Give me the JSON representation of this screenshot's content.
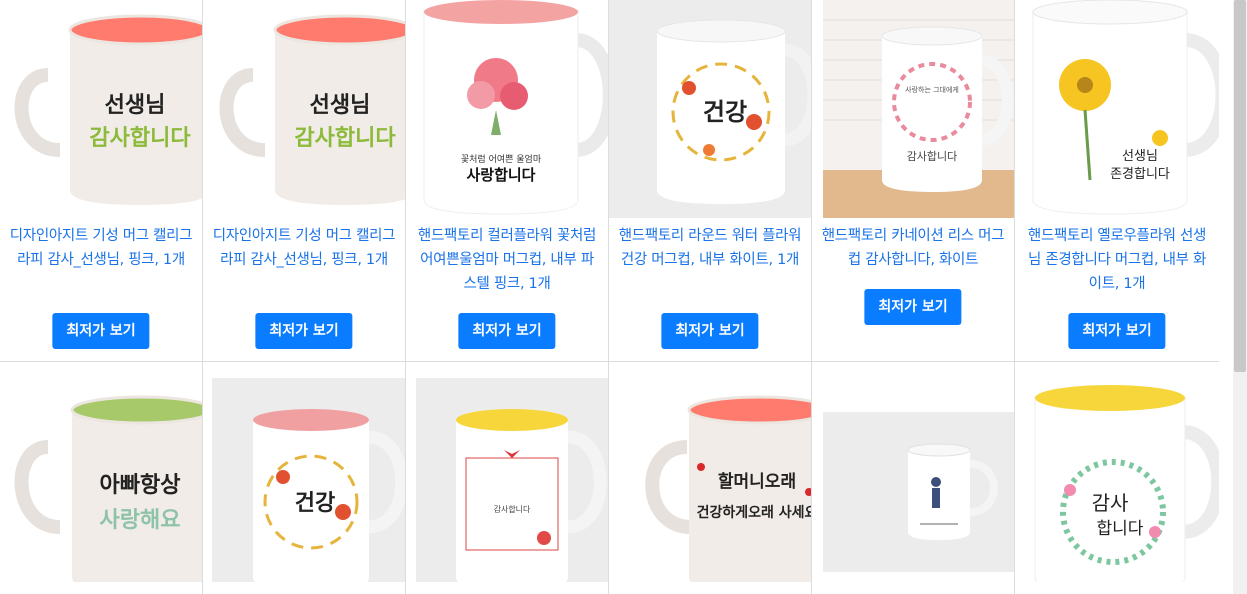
{
  "products_row1": [
    {
      "title": "디자인아지트 기성 머그 캘리그라피 감사_선생님, 핑크, 1개",
      "button": "최저가 보기",
      "mug_text_top": "선생님",
      "mug_text_bottom": "감사합니다",
      "inner_color": "#ff7b6e"
    },
    {
      "title": "디자인아지트 기성 머그 캘리그라피 감사_선생님, 핑크, 1개",
      "button": "최저가 보기",
      "mug_text_top": "선생님",
      "mug_text_bottom": "감사합니다",
      "inner_color": "#ff7b6e"
    },
    {
      "title": "핸드팩토리 컬러플라워 꽃처럼어여쁜울엄마 머그컵, 내부 파스텔 핑크, 1개",
      "button": "최저가 보기",
      "mug_text_top": "꽃처럼 어여쁜 울엄마",
      "mug_text_bottom": "사랑합니다",
      "inner_color": "#f4a3a3"
    },
    {
      "title": "핸드팩토리 라운드 워터 플라워 건강 머그컵, 내부 화이트, 1개",
      "button": "최저가 보기",
      "mug_text_top": "",
      "mug_text_bottom": "건강",
      "inner_color": "#ffffff"
    },
    {
      "title": "핸드팩토리 카네이션 리스 머그컵 감사합니다, 화이트",
      "button": "최저가 보기",
      "mug_text_top": "사랑하는 그대에게",
      "mug_text_bottom": "감사합니다",
      "inner_color": "#ffffff"
    },
    {
      "title": "핸드팩토리 옐로우플라워 선생님 존경합니다 머그컵, 내부 화이트, 1개",
      "button": "최저가 보기",
      "mug_text_top": "선생님",
      "mug_text_bottom": "존경합니다",
      "inner_color": "#ffffff"
    }
  ],
  "products_row2": [
    {
      "mug_text_top": "아빠항상",
      "mug_text_bottom": "사랑해요",
      "inner_color": "#a8c96a"
    },
    {
      "mug_text_top": "",
      "mug_text_bottom": "건강",
      "inner_color": "#f0a0a0"
    },
    {
      "mug_text_top": "",
      "mug_text_bottom": "감사합니다",
      "inner_color": "#f6d63a"
    },
    {
      "mug_text_top": "할머니오래",
      "mug_text_bottom": "건강하게오래 사세요",
      "inner_color": "#ff7b6e"
    },
    {
      "mug_text_top": "",
      "mug_text_bottom": "",
      "inner_color": "#ffffff"
    },
    {
      "mug_text_top": "감사",
      "mug_text_bottom": "합니다",
      "inner_color": "#f6d63a"
    }
  ],
  "colors": {
    "link": "#1a73e8",
    "button": "#0a7cff",
    "border": "#dcdcdc"
  }
}
